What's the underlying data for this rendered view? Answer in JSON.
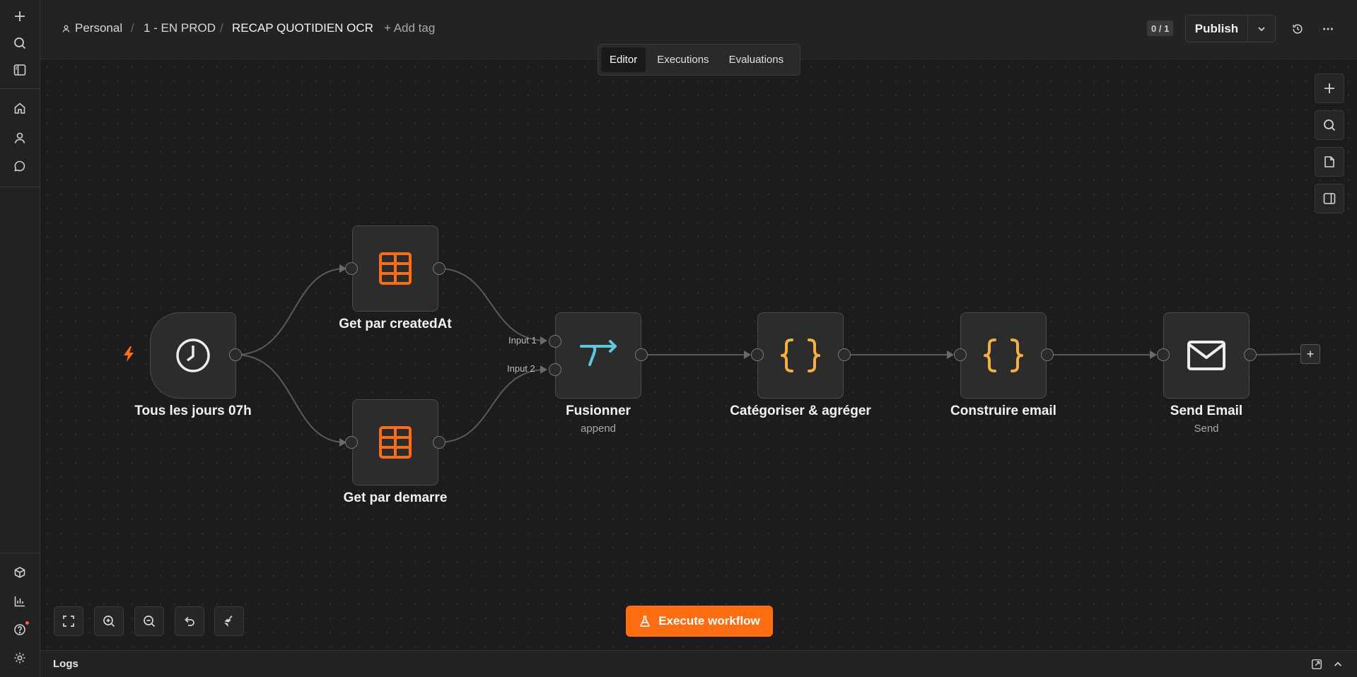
{
  "header": {
    "project": "Personal",
    "folder": "1 - EN PROD",
    "workflow_name": "RECAP QUOTIDIEN OCR",
    "add_tag": "+ Add tag",
    "counter": "0 / 1",
    "publish": "Publish"
  },
  "tabs": [
    {
      "label": "Editor",
      "active": true
    },
    {
      "label": "Executions",
      "active": false
    },
    {
      "label": "Evaluations",
      "active": false
    }
  ],
  "nodes": {
    "trigger": {
      "label": "Tous les jours 07h",
      "icon": "clock-icon"
    },
    "get_created": {
      "label": "Get par createdAt",
      "icon": "table-icon"
    },
    "get_demarre": {
      "label": "Get par demarre",
      "icon": "table-icon"
    },
    "merge": {
      "label": "Fusionner",
      "subtitle": "append",
      "icon": "merge-icon",
      "input1": "Input 1",
      "input2": "Input 2"
    },
    "categorize": {
      "label": "Catégoriser & agréger",
      "icon": "code-braces-icon"
    },
    "build_email": {
      "label": "Construire email",
      "icon": "code-braces-icon"
    },
    "send_email": {
      "label": "Send Email",
      "subtitle": "Send",
      "icon": "envelope-icon"
    }
  },
  "execute_button": "Execute workflow",
  "logs": {
    "label": "Logs"
  },
  "colors": {
    "accent": "#ff6d12",
    "table_icon": "#ff6d12",
    "code_icon": "#f5b041",
    "merge_icon": "#5ec7e0"
  }
}
